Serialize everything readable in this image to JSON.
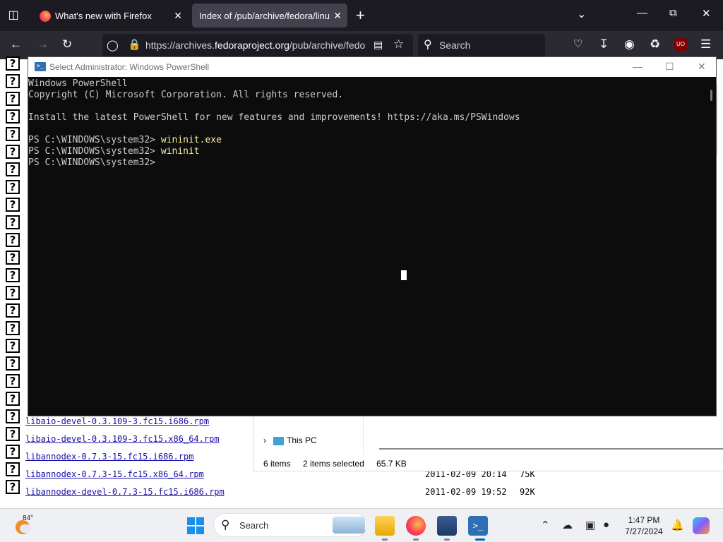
{
  "browser": {
    "tabs": [
      {
        "title": "What's new with Firefox",
        "active": false
      },
      {
        "title": "Index of /pub/archive/fedora/linux",
        "active": true
      }
    ],
    "url_prefix": "https://archives.",
    "url_domain": "fedoraproject.org",
    "url_path": "/pub/archive/fedora/linux",
    "search_placeholder": "Search",
    "extension_badge": "UO"
  },
  "listing": {
    "rows": [
      {
        "name": "libaio-devel-0.3.109-3.fc15.i686.rpm",
        "date": "",
        "size": ""
      },
      {
        "name": "libaio-devel-0.3.109-3.fc15.x86_64.rpm",
        "date": "",
        "size": ""
      },
      {
        "name": "libannodex-0.7.3-15.fc15.i686.rpm",
        "date": "",
        "size": ""
      },
      {
        "name": "libannodex-0.7.3-15.fc15.x86_64.rpm",
        "date": "2011-02-09 20:14",
        "size": "75K"
      },
      {
        "name": "libannodex-devel-0.7.3-15.fc15.i686.rpm",
        "date": "2011-02-09 19:52",
        "size": "92K"
      }
    ]
  },
  "explorer": {
    "nav_item": "This PC",
    "status_items": "6 items",
    "status_selected": "2 items selected",
    "status_size": "65.7 KB"
  },
  "powershell": {
    "title": "Select Administrator: Windows PowerShell",
    "lines": [
      {
        "text": "Windows PowerShell",
        "cmd": ""
      },
      {
        "text": "Copyright (C) Microsoft Corporation. All rights reserved.",
        "cmd": ""
      },
      {
        "text": "",
        "cmd": ""
      },
      {
        "text": "Install the latest PowerShell for new features and improvements! https://aka.ms/PSWindows",
        "cmd": ""
      },
      {
        "text": "",
        "cmd": ""
      },
      {
        "text": "PS C:\\WINDOWS\\system32> ",
        "cmd": "wininit.exe"
      },
      {
        "text": "PS C:\\WINDOWS\\system32> ",
        "cmd": "wininit"
      },
      {
        "text": "PS C:\\WINDOWS\\system32>",
        "cmd": ""
      }
    ]
  },
  "taskbar": {
    "temperature": "84°",
    "search_label": "Search",
    "time": "1:47 PM",
    "date": "7/27/2024"
  },
  "colors": {
    "console_bg": "#0c0c0c",
    "console_text": "#cccccc",
    "console_command": "#f9f1a5",
    "link": "#1a0dab",
    "firefox_chrome": "#1c1b22"
  }
}
